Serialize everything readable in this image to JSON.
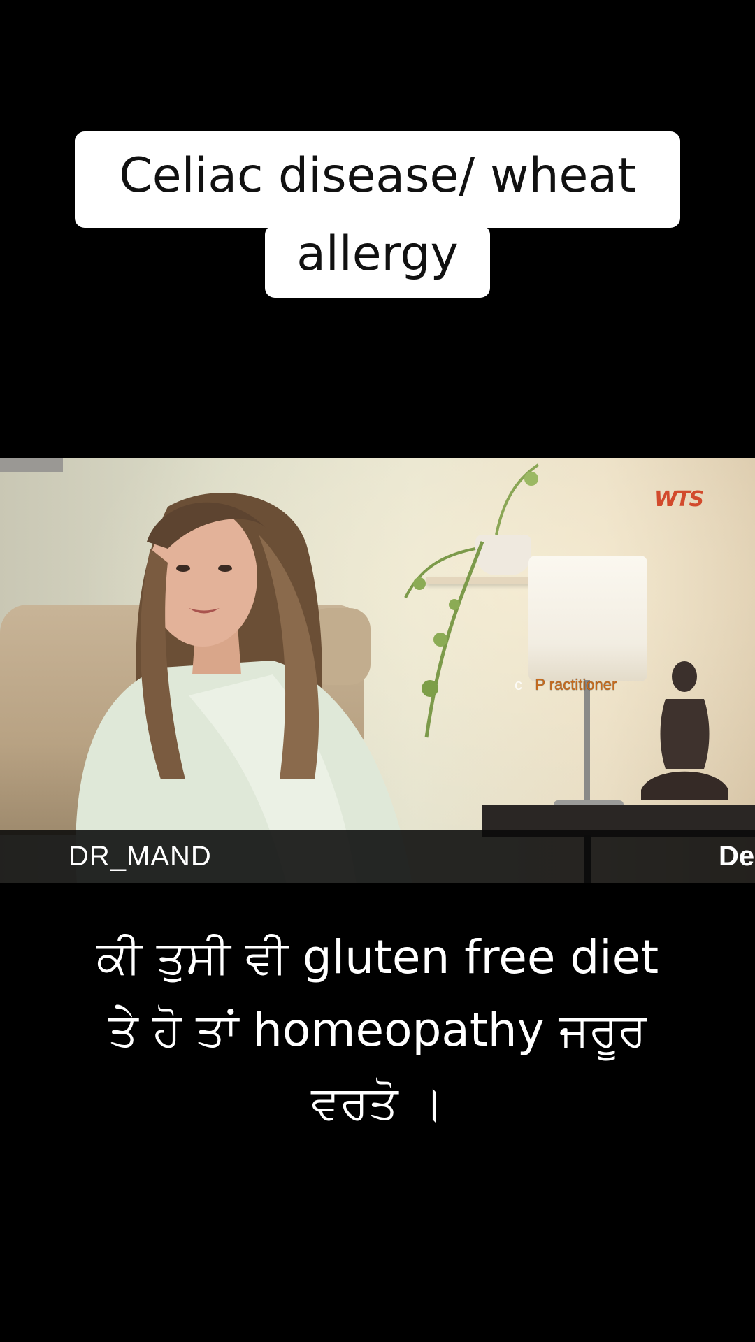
{
  "title_caption": {
    "line1": "Celiac disease/ wheat",
    "line2": "allergy"
  },
  "video": {
    "watermark": "WTS",
    "overlay_prefix": "c",
    "overlay_text": "P ractitioner",
    "name_bar_label": "DR_MAND",
    "name_bar_right": "De"
  },
  "bottom_caption": {
    "line1": "ਕੀ ਤੁਸੀ ਵੀ gluten free diet",
    "line2": "ਤੇ ਹੋ ਤਾਂ homeopathy ਜਰੂਰ",
    "line3": "ਵਰਤੋ ।"
  }
}
